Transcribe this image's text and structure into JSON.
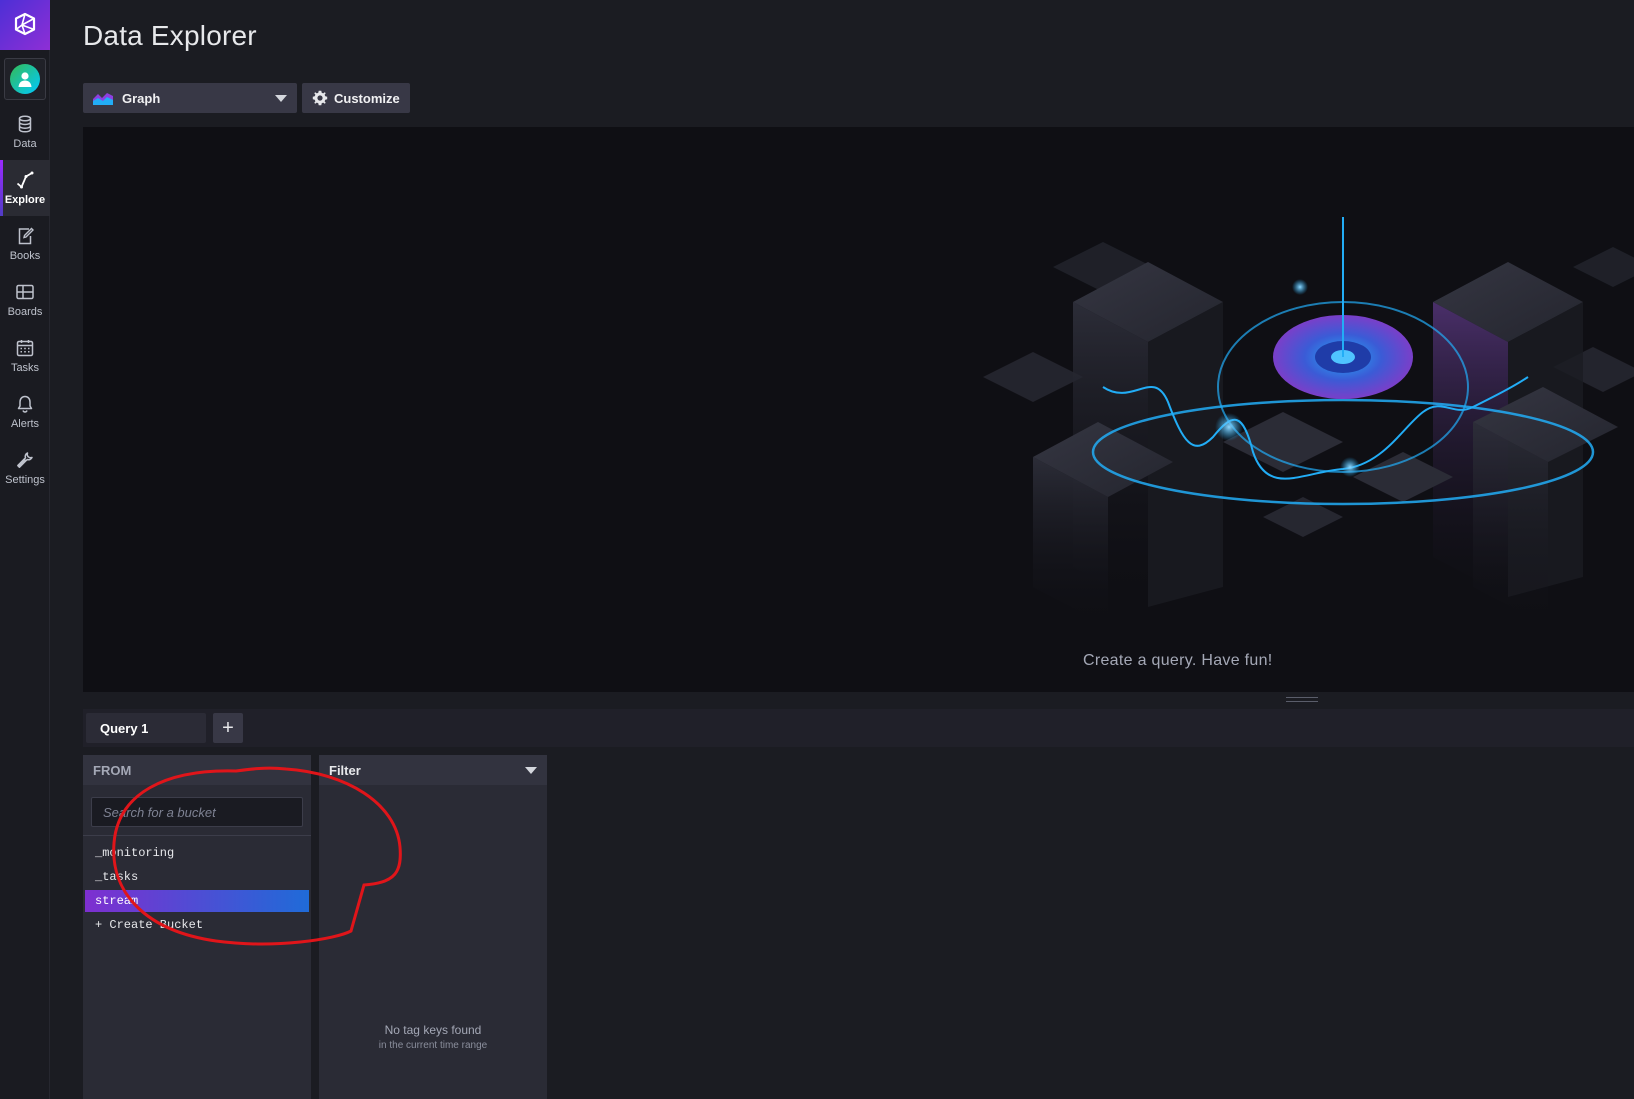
{
  "sidebar": {
    "items": [
      {
        "label": "Data",
        "icon": "database-icon"
      },
      {
        "label": "Explore",
        "icon": "explore-graph-icon",
        "active": true
      },
      {
        "label": "Books",
        "icon": "notebook-icon"
      },
      {
        "label": "Boards",
        "icon": "dashboard-grid-icon"
      },
      {
        "label": "Tasks",
        "icon": "calendar-icon"
      },
      {
        "label": "Alerts",
        "icon": "bell-icon"
      },
      {
        "label": "Settings",
        "icon": "wrench-icon"
      }
    ]
  },
  "header": {
    "title": "Data Explorer"
  },
  "toolbar": {
    "view_type": "Graph",
    "customize_label": "Customize"
  },
  "graph": {
    "empty_message": "Create a query. Have fun!"
  },
  "query": {
    "tab_label": "Query 1",
    "add_label": "+"
  },
  "from": {
    "header": "FROM",
    "search_placeholder": "Search for a bucket",
    "buckets": [
      "_monitoring",
      "_tasks",
      "stream"
    ],
    "selected_bucket": "stream",
    "create_label": "+ Create Bucket"
  },
  "filter": {
    "header": "Filter",
    "empty_title": "No tag keys found",
    "empty_subtitle": "in the current time range"
  },
  "colors": {
    "accent_purple": "#7e2fd0",
    "accent_blue": "#1f6bd8",
    "annotation_red": "#e0151a"
  }
}
